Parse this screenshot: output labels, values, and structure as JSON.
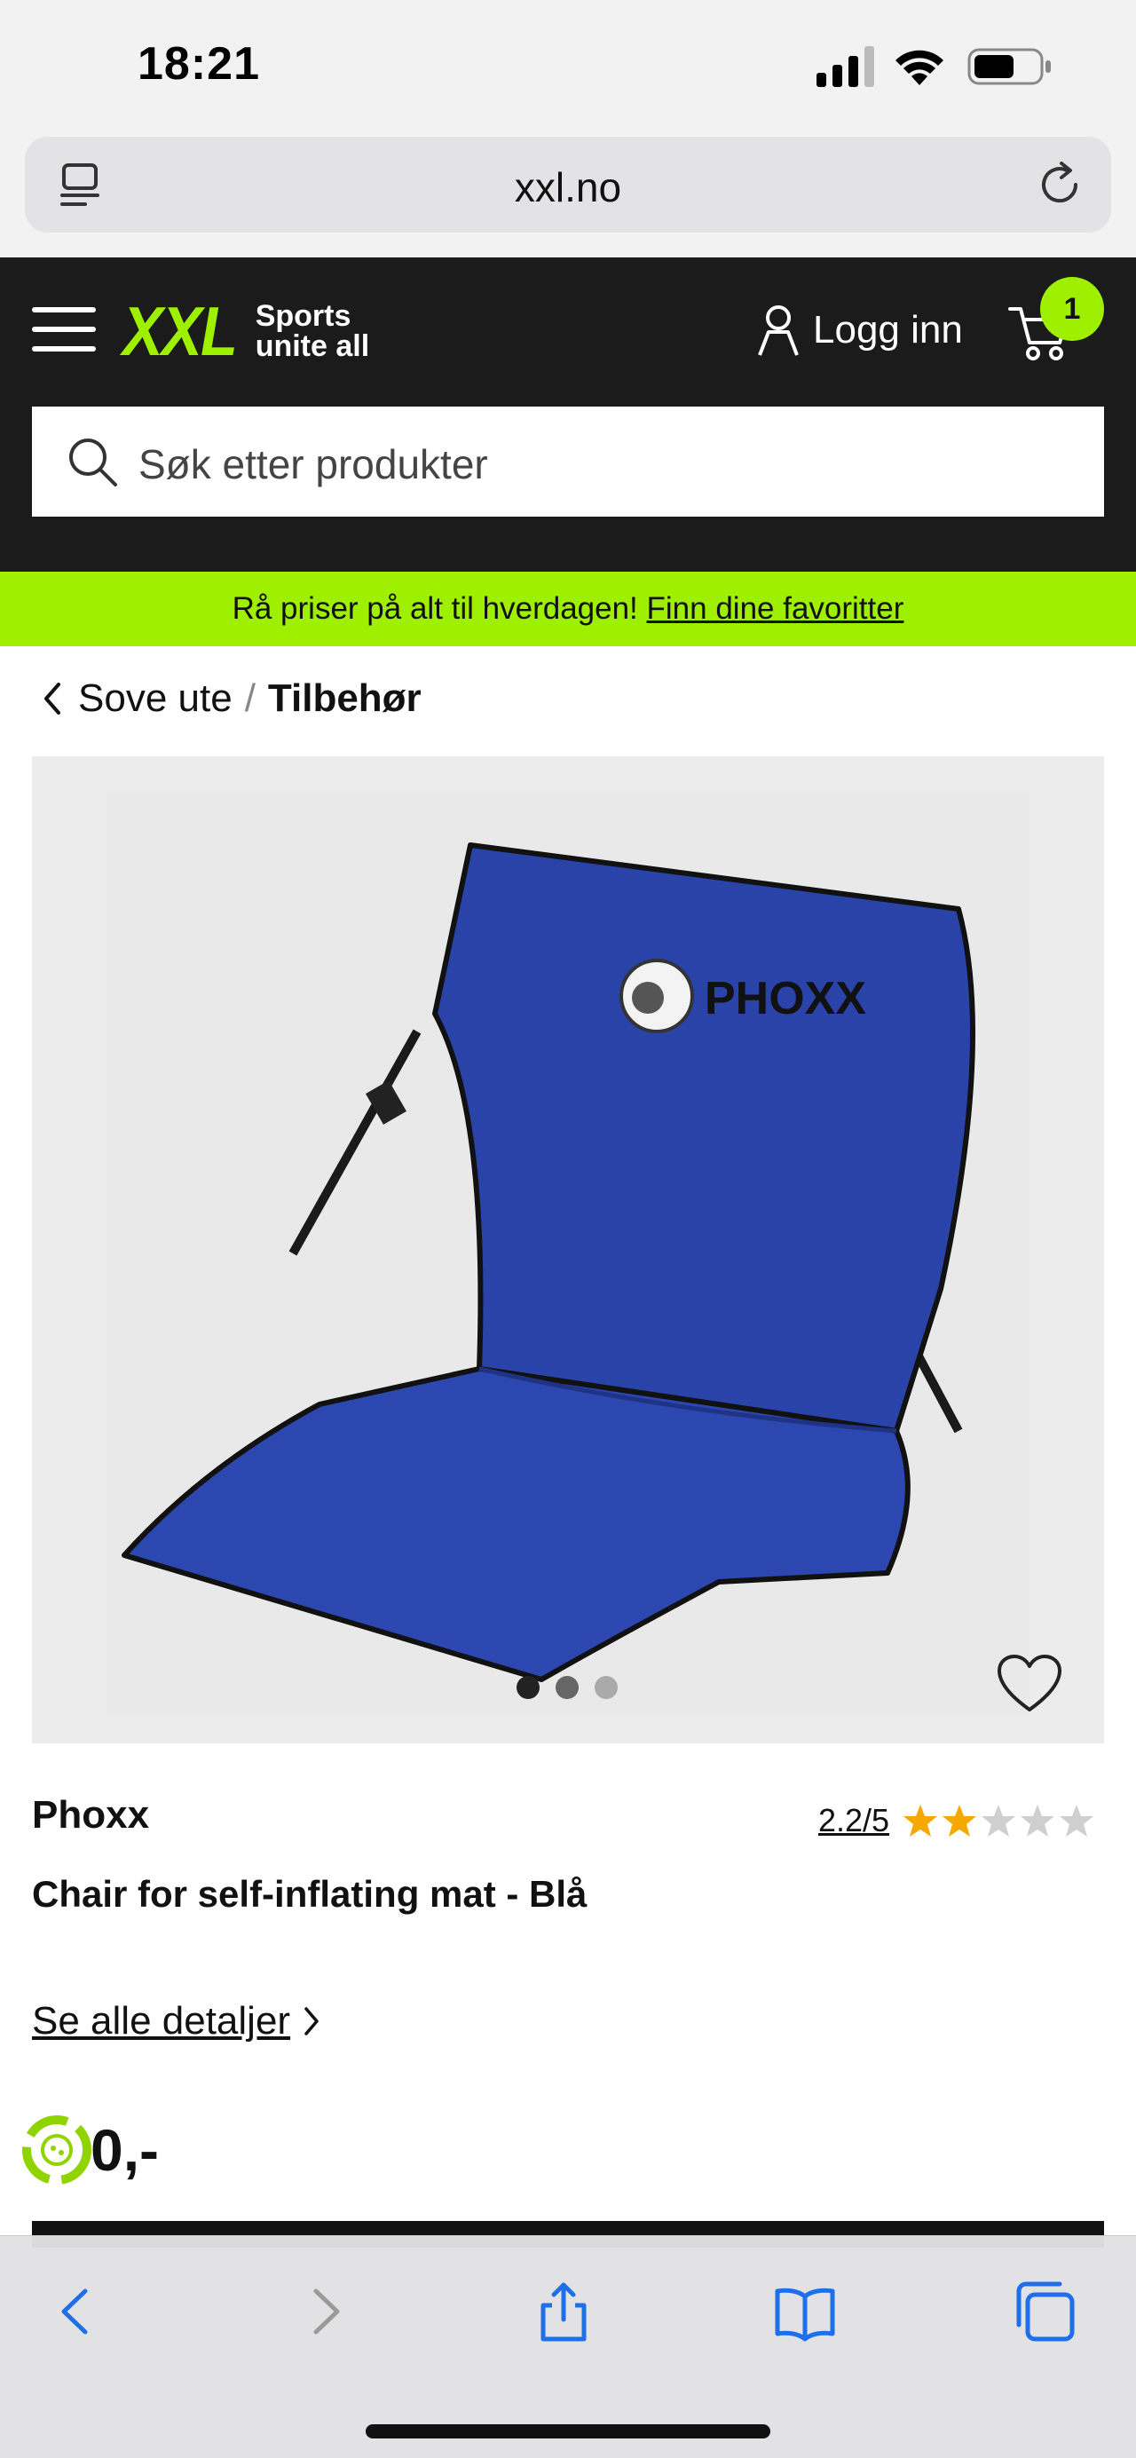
{
  "status": {
    "time": "18:21"
  },
  "browser": {
    "url": "xxl.no"
  },
  "header": {
    "logo_mark": "XXL",
    "logo_tagline_1": "Sports",
    "logo_tagline_2": "unite all",
    "login_label": "Logg inn",
    "cart_count": "1",
    "search_placeholder": "Søk etter produkter"
  },
  "promo": {
    "text": "Rå priser på alt til hverdagen! ",
    "link": "Finn dine favoritter"
  },
  "breadcrumb": {
    "parent": "Sove ute",
    "separator": "/",
    "current": "Tilbehør"
  },
  "gallery": {
    "image_brand_text": "PHOXX",
    "slide_count": 3,
    "active_slide": 1
  },
  "product": {
    "brand": "Phoxx",
    "rating_text": "2.2/5",
    "rating_value": 2.2,
    "rating_max": 5,
    "name": "Chair for self-inflating mat - Blå",
    "details_link": "Se alle detaljer",
    "price": "0,-"
  },
  "colors": {
    "accent": "#9ef000",
    "header_bg": "#1b1b1b",
    "product_blue": "#2a43a8",
    "star_filled": "#f5a800",
    "star_empty": "#cfcfcf"
  },
  "icons": {
    "status": [
      "signal-icon",
      "wifi-icon",
      "battery-icon"
    ],
    "toolbar": [
      "back-icon",
      "forward-icon",
      "share-icon",
      "bookmarks-icon",
      "tabs-icon"
    ]
  }
}
